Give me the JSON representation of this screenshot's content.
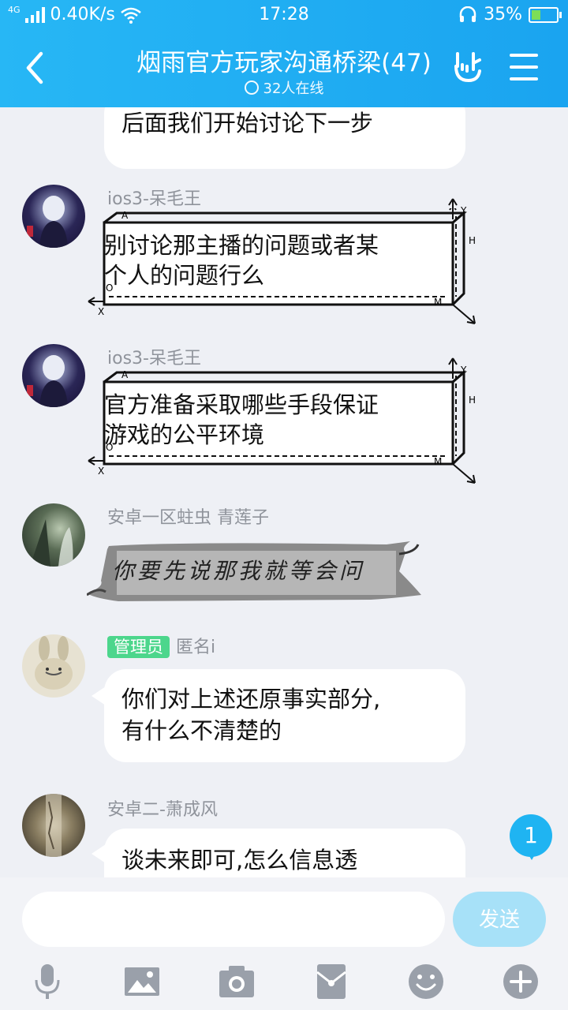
{
  "status_bar": {
    "network": "4G",
    "speed": "0.40K/s",
    "time": "17:28",
    "battery": "35%",
    "battery_level": 0.35
  },
  "header": {
    "title": "烟雨官方玩家沟通桥梁(47)",
    "online": "32人在线"
  },
  "messages": [
    {
      "text": "后面我们开始讨论下一步"
    },
    {
      "sender": "ios3-呆毛王",
      "text": "别讨论那主播的问题或者某个人的问题行么",
      "line1": "别讨论那主播的问题或者某",
      "line2": "个人的问题行么",
      "style": "box"
    },
    {
      "sender": "ios3-呆毛王",
      "text": "官方准备采取哪些手段保证游戏的公平环境",
      "line1": "官方准备采取哪些手段保证",
      "line2": "游戏的公平环境",
      "style": "box"
    },
    {
      "sender": "安卓一区蛀虫 青莲子",
      "text": "你要先说那我就等会问",
      "style": "ink"
    },
    {
      "badge": "管理员",
      "sender": "匿名i",
      "line1": "你们对上述还原事实部分,",
      "line2": "有什么不清楚的"
    },
    {
      "sender": "安卓二-萧成风",
      "line1": "谈未来即可,怎么信息透"
    }
  ],
  "box_labels": {
    "a": "A",
    "o": "O",
    "x": "X",
    "y": "Y",
    "h": "H",
    "m": "M"
  },
  "new_message_count": "1",
  "input": {
    "placeholder": "",
    "send_label": "发送"
  },
  "colors": {
    "header": "#1aa4f0",
    "background": "#eef0f5",
    "admin_badge": "#4cd68c",
    "send_disabled": "#a7e1f8"
  }
}
